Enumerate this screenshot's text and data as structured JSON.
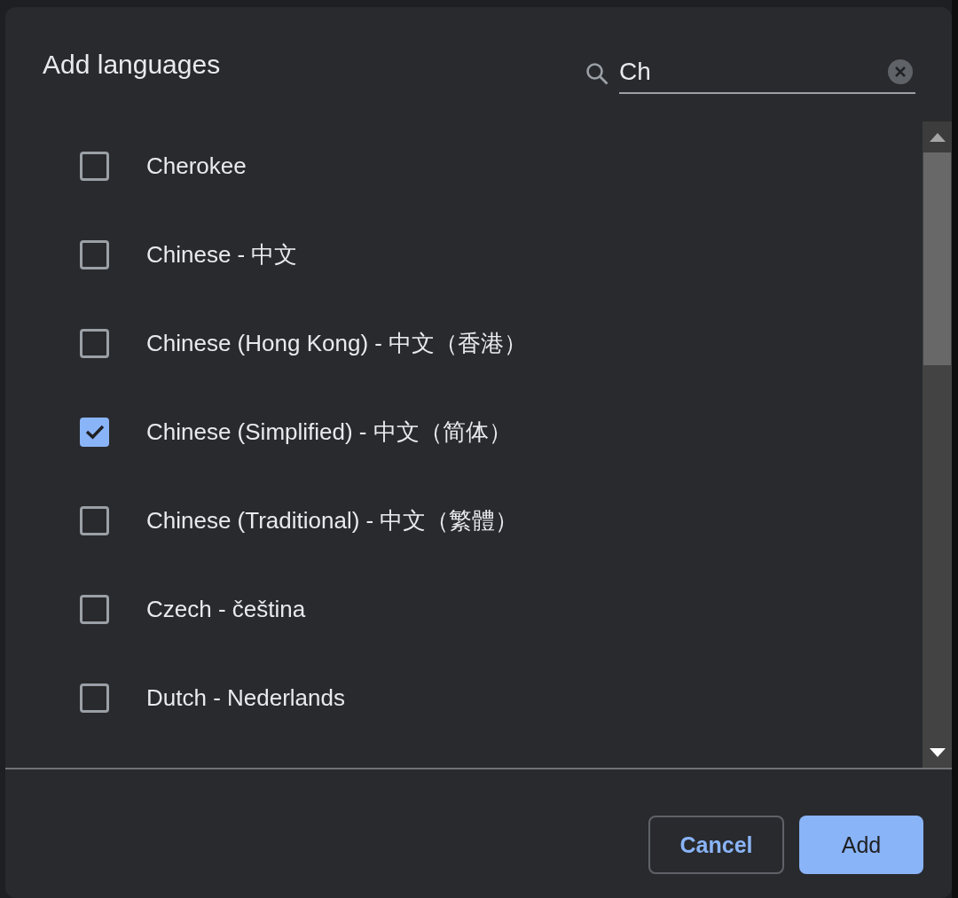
{
  "title": "Add languages",
  "search": {
    "value": "Ch"
  },
  "languages": [
    {
      "label": "Cherokee",
      "checked": false
    },
    {
      "label": "Chinese - 中文",
      "checked": false
    },
    {
      "label": "Chinese (Hong Kong) - 中文（香港）",
      "checked": false
    },
    {
      "label": "Chinese (Simplified) - 中文（简体）",
      "checked": true
    },
    {
      "label": "Chinese (Traditional) - 中文（繁體）",
      "checked": false
    },
    {
      "label": "Czech - čeština",
      "checked": false
    },
    {
      "label": "Dutch - Nederlands",
      "checked": false
    }
  ],
  "buttons": [
    {
      "label": "Cancel",
      "kind": "secondary"
    },
    {
      "label": "Add",
      "kind": "primary"
    }
  ]
}
